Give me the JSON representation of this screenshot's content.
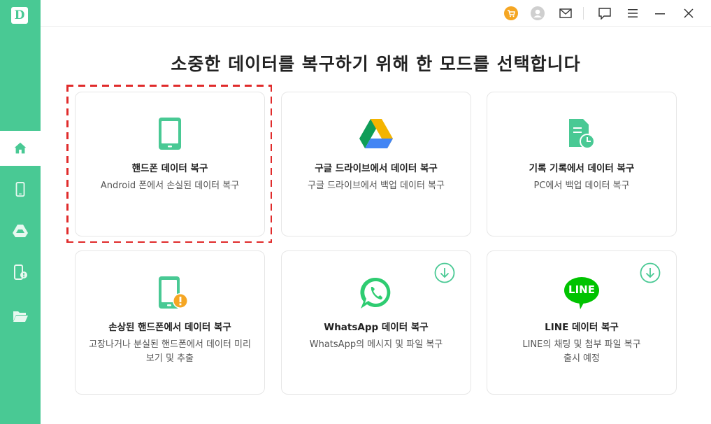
{
  "app": {
    "logo_letter": "D"
  },
  "topbar": {
    "icons": [
      "cart-icon",
      "account-icon",
      "mail-icon",
      "feedback-icon",
      "menu-icon",
      "minimize-icon",
      "close-icon"
    ],
    "accent": "#f5a623"
  },
  "sidebar": {
    "accent": "#49c994",
    "items": [
      {
        "icon": "home-icon",
        "active": true
      },
      {
        "icon": "phone-icon",
        "active": false
      },
      {
        "icon": "google-drive-icon",
        "active": false
      },
      {
        "icon": "phone-history-icon",
        "active": false
      },
      {
        "icon": "folder-icon",
        "active": false
      }
    ]
  },
  "main": {
    "title": "소중한 데이터를 복구하기 위해 한 모드를 선택합니다",
    "cards": [
      {
        "title": "핸드폰 데이터 복구",
        "desc": "Android 폰에서 손실된 데이터 복구",
        "icon": "phone-icon",
        "selected": true
      },
      {
        "title": "구글 드라이브에서 데이터 복구",
        "desc": "구글 드라이브에서 백업 데이터 복구",
        "icon": "google-drive-icon"
      },
      {
        "title": "기록 기록에서 데이터 복구",
        "desc": "PC에서 백업 데이터 복구",
        "icon": "document-clock-icon"
      },
      {
        "title": "손상된 핸드폰에서 데이터 복구",
        "desc": "고장나거나 분실된 핸드폰에서 데이터 미리 보기 및 추출",
        "icon": "broken-phone-icon"
      },
      {
        "title": "WhatsApp 데이터 복구",
        "desc": "WhatsApp의 메시지 및 파일 복구",
        "icon": "whatsapp-icon",
        "download": true
      },
      {
        "title": "LINE 데이터 복구",
        "desc": "LINE의 채팅 및 첨부 파일 복구\n출시 예정",
        "icon": "line-icon",
        "download": true,
        "logo_text": "LINE"
      }
    ]
  }
}
